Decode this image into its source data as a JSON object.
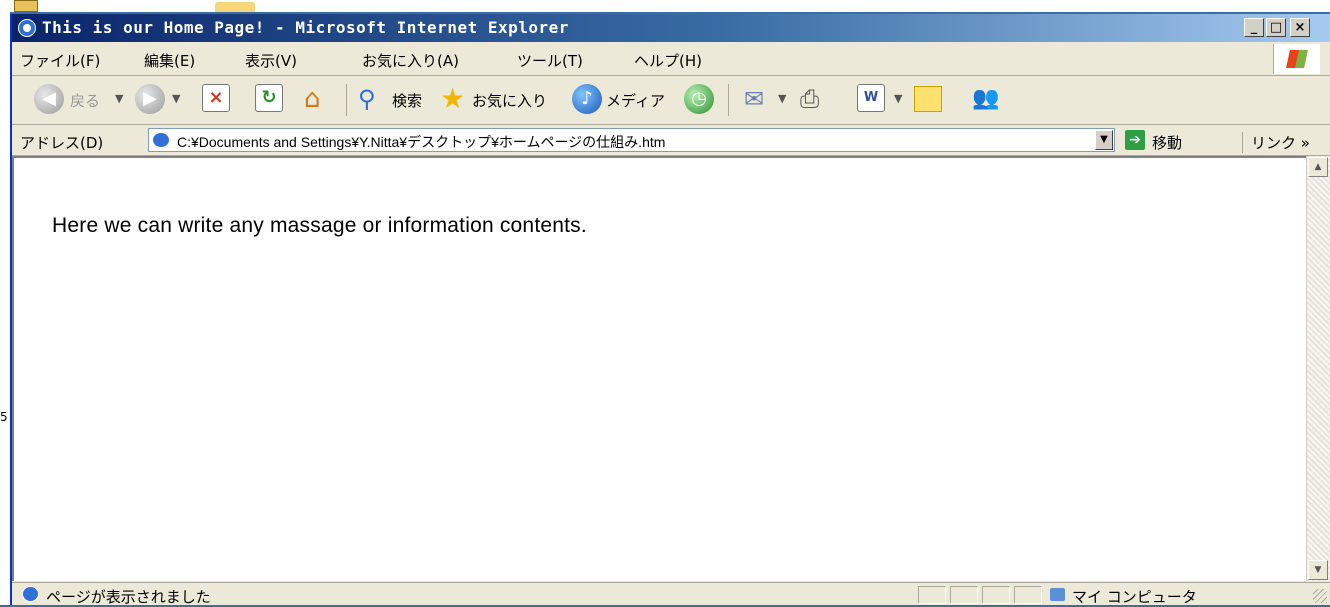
{
  "desktop": {
    "side_digit": "5"
  },
  "window": {
    "title": "This is our Home Page! - Microsoft Internet Explorer",
    "controls": {
      "minimize": "_",
      "maximize": "□",
      "close": "×"
    }
  },
  "menubar": {
    "items": [
      "ファイル(F)",
      "編集(E)",
      "表示(V)",
      "お気に入り(A)",
      "ツール(T)",
      "ヘルプ(H)"
    ]
  },
  "toolbar": {
    "back_label": "戻る",
    "search_label": "検索",
    "favorites_label": "お気に入り",
    "media_label": "メディア",
    "icons": [
      "back-icon",
      "forward-icon",
      "stop-icon",
      "refresh-icon",
      "home-icon",
      "search-icon",
      "favorites-star-icon",
      "media-icon",
      "history-icon",
      "mail-icon",
      "print-icon",
      "edit-icon",
      "discuss-icon",
      "messenger-icon"
    ]
  },
  "addressbar": {
    "label": "アドレス(D)",
    "value": "C:¥Documents and Settings¥Y.Nitta¥デスクトップ¥ホームページの仕組み.htm",
    "go_label": "移動",
    "links_label": "リンク »"
  },
  "content": {
    "text": "Here we can write any massage or information contents."
  },
  "statusbar": {
    "text": "ページが表示されました",
    "zone": "マイ コンピュータ"
  },
  "colors": {
    "title_gradient_start": "#0a246a",
    "title_gradient_end": "#a6caf0",
    "chrome": "#ece9d8",
    "go_green": "#2ea043"
  }
}
